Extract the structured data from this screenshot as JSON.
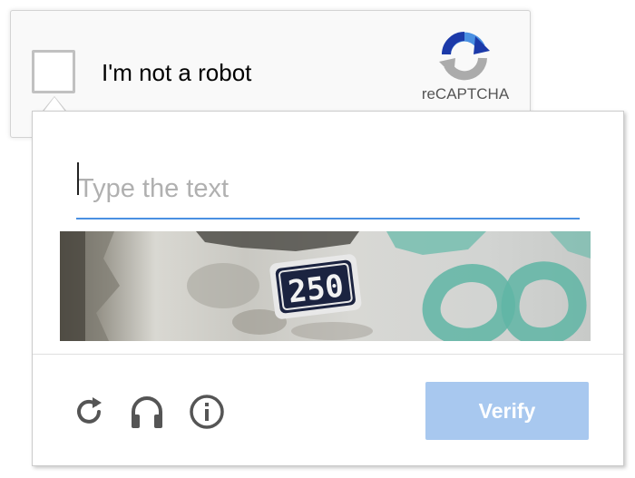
{
  "anchor": {
    "label": "I'm not a robot",
    "checked": false,
    "brand_text": "reCAPTCHA",
    "logo_icon": "recaptcha-logo-icon"
  },
  "challenge": {
    "input": {
      "value": "",
      "placeholder": "Type the text"
    },
    "image": {
      "plate_text": "250"
    },
    "controls": {
      "reload_icon": "reload-icon",
      "audio_icon": "headphones-icon",
      "help_icon": "info-icon"
    },
    "verify_label": "Verify"
  },
  "colors": {
    "accent": "#4a90e2",
    "verify_disabled": "#a8c8ef",
    "logo_blue": "#1c3aa9",
    "logo_light_blue": "#4a90e2",
    "logo_gray": "#ababab",
    "icon_gray": "#555555"
  }
}
